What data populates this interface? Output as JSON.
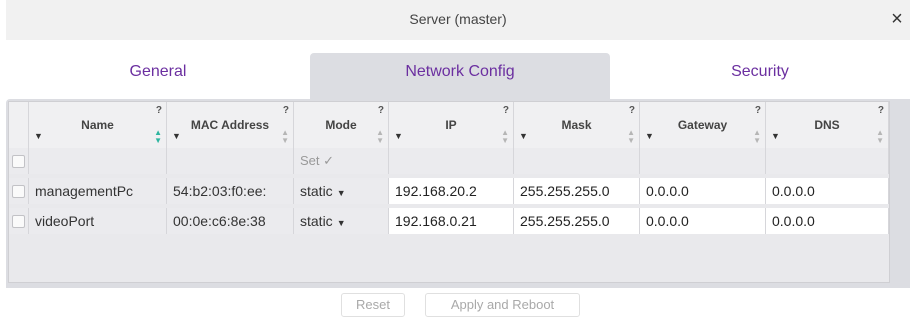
{
  "window": {
    "title": "Server (master)",
    "close_glyph": "×"
  },
  "tabs": [
    {
      "label": "General",
      "active": false
    },
    {
      "label": "Network Config",
      "active": true
    },
    {
      "label": "Security",
      "active": false
    }
  ],
  "table": {
    "columns": [
      "Name",
      "MAC Address",
      "Mode",
      "IP",
      "Mask",
      "Gateway",
      "DNS"
    ],
    "help_glyph": "?",
    "filter_row": {
      "mode_set_label": "Set ✓"
    },
    "rows": [
      {
        "name": "managementPc",
        "mac": "54:b2:03:f0:ee:",
        "mode": "static",
        "ip": "192.168.20.2",
        "mask": "255.255.255.0",
        "gateway": "0.0.0.0",
        "dns": "0.0.0.0"
      },
      {
        "name": "videoPort",
        "mac": "00:0e:c6:8e:38",
        "mode": "static",
        "ip": "192.168.0.21",
        "mask": "255.255.255.0",
        "gateway": "0.0.0.0",
        "dns": "0.0.0.0"
      }
    ]
  },
  "footer": {
    "reset_label": "Reset",
    "apply_label": "Apply and Reboot"
  },
  "colors": {
    "tab_text": "#6b2fa0",
    "panel_bg": "#dcdde2",
    "sort_active": "#2db5a0"
  }
}
